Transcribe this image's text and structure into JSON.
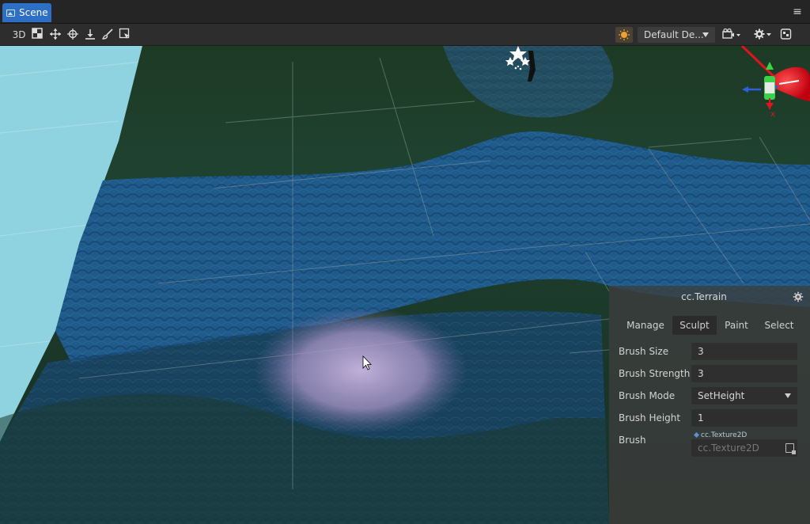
{
  "tab": {
    "title": "Scene"
  },
  "toolbar": {
    "mode_label": "3D",
    "camera_dropdown": "Default De..."
  },
  "terrain_panel": {
    "title": "cc.Terrain",
    "tabs": [
      {
        "label": "Manage"
      },
      {
        "label": "Sculpt"
      },
      {
        "label": "Paint"
      },
      {
        "label": "Select"
      }
    ],
    "active_tab": "Sculpt",
    "fields": {
      "brush_size": {
        "label": "Brush Size",
        "value": "3"
      },
      "brush_strength": {
        "label": "Brush Strength",
        "value": "3"
      },
      "brush_mode": {
        "label": "Brush Mode",
        "value": "SetHeight"
      },
      "brush_height": {
        "label": "Brush Height",
        "value": "1"
      },
      "brush": {
        "label": "Brush",
        "type_tag": "cc.Texture2D",
        "placeholder": "cc.Texture2D"
      }
    }
  },
  "gizmo": {
    "x_label": "x"
  },
  "colors": {
    "tab_active": "#2c6fc4",
    "sky": "#8fd3e0",
    "terrain_green": "#1f3a26",
    "terrain_blue": "#1f5a8a",
    "brush_highlight": "#b8a4d0",
    "gizmo_red": "#e0141e",
    "gizmo_green": "#3bd14a",
    "gizmo_blue": "#2f5fe0"
  }
}
